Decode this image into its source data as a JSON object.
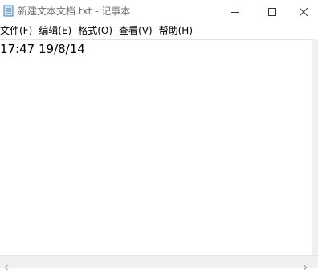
{
  "window": {
    "title": "新建文本文档.txt - 记事本",
    "icons": {
      "app": "notepad-icon",
      "minimize": "minimize-icon",
      "maximize": "maximize-icon",
      "close": "close-icon"
    }
  },
  "menu": {
    "items": [
      {
        "label": "文件(F)"
      },
      {
        "label": "编辑(E)"
      },
      {
        "label": "格式(O)"
      },
      {
        "label": "查看(V)"
      },
      {
        "label": "帮助(H)"
      }
    ]
  },
  "editor": {
    "content": "17:47 19/8/14"
  },
  "colors": {
    "titlebar_bg": "#ffffff",
    "title_text": "#6f6f6f",
    "scrollbar_bg": "#f0f0f0"
  }
}
